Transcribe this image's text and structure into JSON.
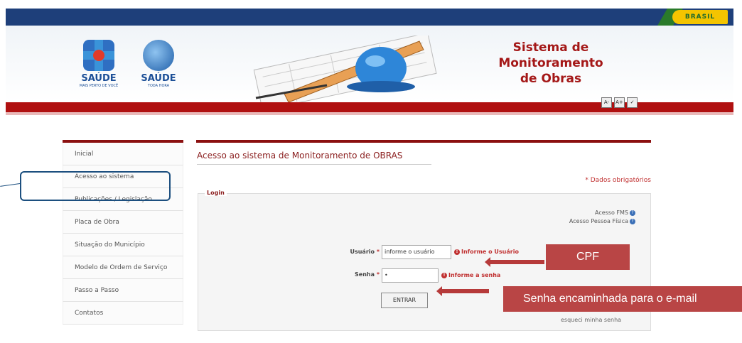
{
  "brand": {
    "brasil": "BRASIL"
  },
  "logos": [
    {
      "name": "SAÚDE",
      "sub": "MAIS PERTO DE VOCÊ"
    },
    {
      "name": "SAÚDE",
      "sub": "TODA HORA"
    }
  ],
  "header": {
    "title_lines": [
      "Sistema de",
      "Monitoramento",
      "de Obras"
    ]
  },
  "font_controls": [
    "A-",
    "A+",
    "✓"
  ],
  "sidebar": {
    "items": [
      {
        "label": "Inicial"
      },
      {
        "label": "Acesso ao sistema"
      },
      {
        "label": "Publicações / Legislação"
      },
      {
        "label": "Placa de Obra"
      },
      {
        "label": "Situação do Município"
      },
      {
        "label": "Modelo de Ordem de Serviço"
      },
      {
        "label": "Passo a Passo"
      },
      {
        "label": "Contatos"
      }
    ]
  },
  "main": {
    "title": "Acesso ao sistema de Monitoramento de OBRAS",
    "required_note": "* Dados obrigatórios",
    "login_legend": "Login",
    "acesso_fms": "Acesso FMS",
    "acesso_pf": "Acesso Pessoa Física",
    "usuario_label": "Usuário",
    "usuario_value": "informe o usuário",
    "usuario_error": "Informe o Usuário",
    "senha_label": "Senha",
    "senha_value": "•",
    "senha_error": "Informe a senha",
    "submit": "ENTRAR",
    "forgot": "esqueci minha senha",
    "required_mark": "*"
  },
  "annotations": {
    "cpf": "CPF",
    "senha": "Senha encaminhada para o e-mail"
  },
  "colors": {
    "accent_red": "#b01010",
    "nav_blue": "#1e3f7a",
    "callout": "#b94545"
  }
}
